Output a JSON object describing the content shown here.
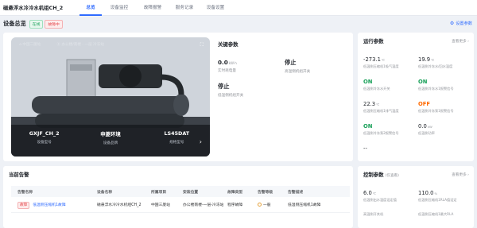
{
  "app": {
    "title": "磁悬浮水冷冷水机组CH_2"
  },
  "nav": {
    "tabs": [
      "总览",
      "设备监控",
      "故障报警",
      "服务记录",
      "设备设置"
    ],
    "active_index": 0
  },
  "overview": {
    "title": "设备总览",
    "badge_online": "在线",
    "badge_fault": "故障中",
    "settings_label": "设置参数"
  },
  "photo": {
    "location_label": "中国二厦站",
    "site_label": "办公楼/南楼 - 一层 冷冻站",
    "info": [
      {
        "value": "GXJF_CH_2",
        "label": "设备型号"
      },
      {
        "value": "申菱环境",
        "label": "设备品牌"
      },
      {
        "value": "LS45DAT",
        "label": "规格型号"
      }
    ]
  },
  "key_params": {
    "title": "关键参数",
    "items": [
      {
        "value": "0.0",
        "unit": "kW·h",
        "label": "实时耗电量"
      },
      {
        "value": "停止",
        "unit": "",
        "label": "高温侧机组开关"
      },
      {
        "value": "停止",
        "unit": "",
        "label": "低温侧机组开关"
      }
    ]
  },
  "run_params": {
    "title": "运行参数",
    "more": "查看更多",
    "items": [
      {
        "value": "-273.1",
        "unit": "℃",
        "label": "低温侧压缩机1吸气温度",
        "status": ""
      },
      {
        "value": "19.9",
        "unit": "℃",
        "label": "低温侧冷冻水/回水温度",
        "status": ""
      },
      {
        "value": "ON",
        "unit": "",
        "label": "低温侧冷冻水开关",
        "status": "on"
      },
      {
        "value": "ON",
        "unit": "",
        "label": "低温侧冷冻水1报警信号",
        "status": "on"
      },
      {
        "value": "22.3",
        "unit": "℃",
        "label": "低温侧压缩机1排气温度",
        "status": ""
      },
      {
        "value": "OFF",
        "unit": "",
        "label": "低温侧冷冻泵1报警信号",
        "status": "off"
      },
      {
        "value": "ON",
        "unit": "",
        "label": "低温侧冷冻泵2报警信号",
        "status": "on"
      },
      {
        "value": "0.0",
        "unit": "kW",
        "label": "低温侧功率",
        "status": ""
      },
      {
        "value": "--",
        "unit": "",
        "label": "",
        "status": ""
      }
    ]
  },
  "alarms": {
    "title": "当前告警",
    "columns": [
      "告警名称",
      "设备名称",
      "所属项目",
      "安装位置",
      "故障类型",
      "告警等级",
      "告警描述"
    ],
    "rows": [
      {
        "tag": "故障",
        "name": "低温侧压缩机1故障",
        "device": "磁悬浮水冷冷水机组CH_2",
        "project": "中国三厦站",
        "location": "办公楼南楼-一层-冷冻站",
        "type": "程序故障",
        "level": "一般",
        "desc": "低温侧压缩机1故障"
      }
    ]
  },
  "control_params": {
    "title": "控制参数",
    "subtitle": "(仅查看)",
    "more": "查看更多",
    "items": [
      {
        "value": "6.0",
        "unit": "℃",
        "label": "低温侧出水温度设定值"
      },
      {
        "value": "110.0",
        "unit": "%",
        "label": "低温侧压缩机1RLA值设定"
      },
      {
        "value": "",
        "unit": "",
        "label": "高温侧开关机"
      },
      {
        "value": "",
        "unit": "",
        "label": "低温侧压缩机1最大RLA"
      }
    ]
  },
  "colors": {
    "accent": "#2f6bff",
    "online": "#18a058",
    "fault": "#e5484d",
    "off": "#ff6a00"
  }
}
